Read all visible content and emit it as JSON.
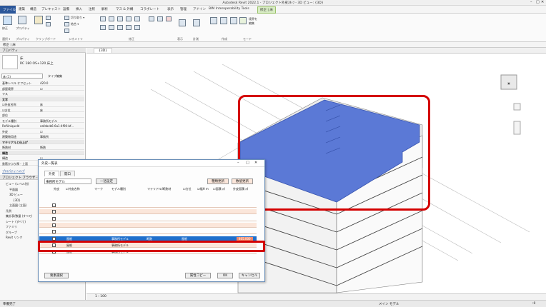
{
  "app": {
    "title": "Autodesk Revit 2022.1 - プロジェクト外皮ｽﾀｯﾌ - 3D ビュー: {3D}"
  },
  "menu_tabs": [
    "ファイル",
    "建築",
    "構造",
    "プレキャスト",
    "設備",
    "挿入",
    "注釈",
    "解析",
    "マス & 外構",
    "コラボレート",
    "表示",
    "管理",
    "アドイン",
    "BIM Interoperability Tools",
    "修正 | 床"
  ],
  "ribbon": {
    "modify_label": "修正",
    "select_label": "選択 ▾",
    "properties_label": "プロパティ",
    "clipboard_label": "クリップボード",
    "geometry_label": "ジオメトリ",
    "edit_label": "修正",
    "view_label": "表示",
    "measure_label": "計測",
    "create_label": "作成",
    "mode_label": "モード",
    "tools": [
      "切り取り ▾",
      "結合 ▾",
      "切り取り",
      "接続"
    ],
    "mode_btn": "境界を\n編集"
  },
  "context_bar": {
    "text": "修正 | 床"
  },
  "properties": {
    "header": "プロパティ",
    "type_name": "床",
    "type_sub": "RC 180 OS+120 床上",
    "filter": "床 (1)",
    "type_edit": "タイプ編集",
    "rows": [
      {
        "k": "基準レベル オフセット",
        "v": "420.0"
      },
      {
        "k": "部屋境界",
        "v": "☑"
      },
      {
        "k": "マス",
        "v": ""
      },
      {
        "k": "文字",
        "v": "",
        "section": true
      },
      {
        "k": "☑外皮名称",
        "v": "床"
      },
      {
        "k": "☑方位",
        "v": "床"
      },
      {
        "k": "部位",
        "v": ""
      },
      {
        "k": "モデル種別",
        "v": "事務所モデル"
      },
      {
        "k": "RefUniqueId",
        "v": "eafebcb6-6a1-4f90-bf..."
      },
      {
        "k": "外皮",
        "v": "☑"
      },
      {
        "k": "建築物用途",
        "v": "事務所"
      },
      {
        "k": "マテリアルと仕上げ",
        "v": "",
        "section": true
      },
      {
        "k": "断熱材",
        "v": "断熱"
      },
      {
        "k": "構造",
        "v": "",
        "section": true
      },
      {
        "k": "構造",
        "v": "☐"
      },
      {
        "k": "鉄筋かぶり厚 - 上面",
        "v": ""
      }
    ],
    "help_link": "プロパティヘルプ",
    "browser_header": "プロジェクト ブラウザ - プロジ...",
    "tree": [
      "ビュー (レベル別)",
      "平面図",
      "3D ビュー",
      "{3D}",
      "立面図 (立面)",
      "凡例",
      "集計表/数量 (すべて)",
      "シート (すべて)",
      "ファミリ",
      "グループ",
      "Revit リンク"
    ]
  },
  "view_tab": {
    "label": "{3D}"
  },
  "status": {
    "scale": "1 : 100",
    "left": "準備完了",
    "model": "メイン モデル",
    "zero": ":0"
  },
  "dialog": {
    "title": "外皮一覧表",
    "tabs": [
      "外皮",
      "開口"
    ],
    "filter_value": "事務所モデル",
    "apply_btn": "一括設定",
    "calc_btn": "種類更新",
    "refresh_btn": "数値更新",
    "columns": [
      "外皮",
      "☑外皮名称",
      "マーク",
      "モデル種別",
      "マテリアル/断熱材",
      "☑方位",
      "☑幅H m",
      "☑面積 ㎡",
      "外皮面積 ㎡"
    ],
    "rows": [
      {
        "style": "plain",
        "name": "",
        "model": "",
        "mat": ""
      },
      {
        "style": "peach",
        "name": "",
        "model": "",
        "mat": ""
      },
      {
        "style": "plain",
        "name": "",
        "model": "",
        "mat": ""
      },
      {
        "style": "peach",
        "name": "",
        "model": "",
        "mat": ""
      },
      {
        "style": "plain",
        "name": "",
        "model": "",
        "mat": ""
      },
      {
        "style": "selected",
        "name": "屋根",
        "model": "事務所モデル",
        "mat": "断熱",
        "dir": "屋根",
        "area": "465.000"
      },
      {
        "style": "peach",
        "name": "屋根",
        "model": "事務所モデル",
        "mat": "",
        "dir": "",
        "area": ""
      },
      {
        "style": "plain",
        "name": "屋根",
        "model": "事務所モデル",
        "mat": "",
        "dir": "",
        "area": ""
      }
    ],
    "footer_left": "要素選択",
    "btn_copy": "属性コピー",
    "btn_ok": "OK",
    "btn_cancel": "キャンセル"
  },
  "colors": {
    "accent": "#2b579a",
    "highlight_red": "#d40000",
    "roof_blue": "#5b79d6",
    "select_blue": "#1e6fcc"
  }
}
